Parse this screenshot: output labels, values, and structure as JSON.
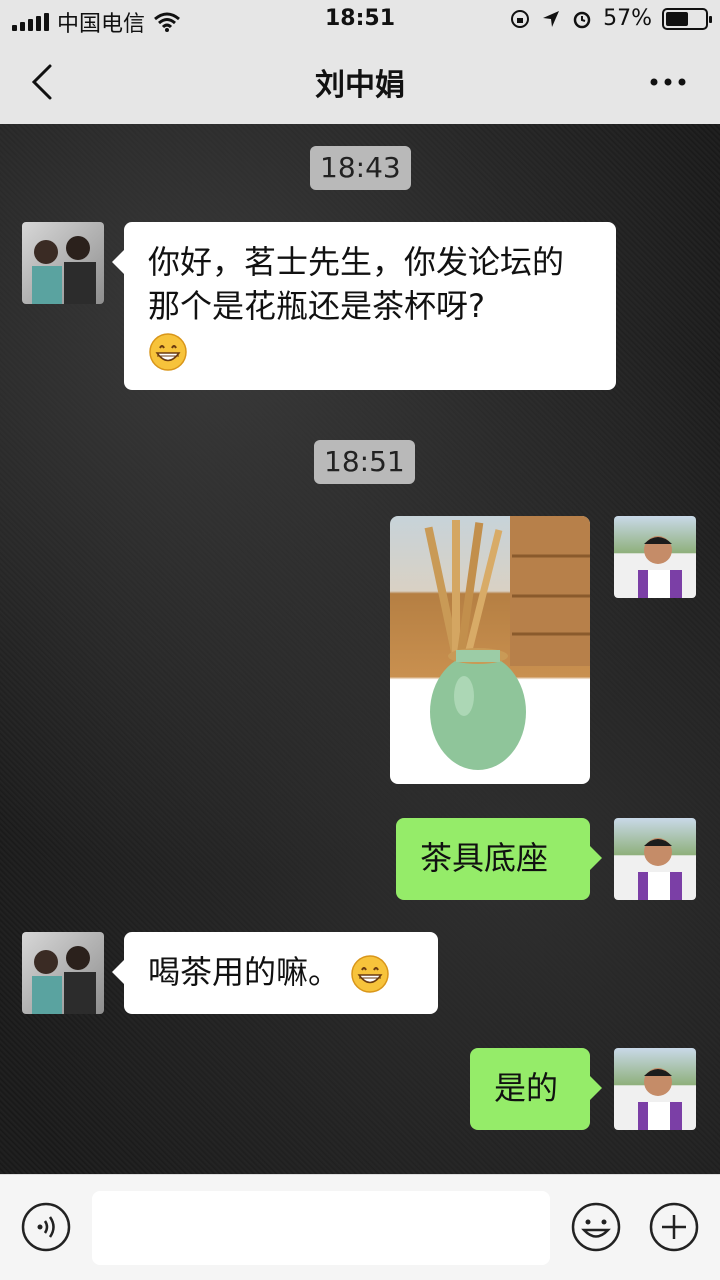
{
  "status_bar": {
    "carrier": "中国电信",
    "time": "18:51",
    "battery": "57%",
    "battery_level": 0.57
  },
  "nav": {
    "title": "刘中娟",
    "back_icon": "chevron-left-icon",
    "more_icon": "more-dots-icon"
  },
  "timestamps": [
    "18:43",
    "18:51"
  ],
  "messages": [
    {
      "side": "left",
      "text": "你好，茗士先生，你发论坛的那个是花瓶还是茶杯呀?",
      "emoji": "grinning-face-icon"
    },
    {
      "side": "right",
      "type": "image"
    },
    {
      "side": "right",
      "text": "茶具底座"
    },
    {
      "side": "left",
      "text": "喝茶用的嘛。",
      "emoji": "grinning-face-icon"
    },
    {
      "side": "right",
      "text": "是的"
    }
  ],
  "input": {
    "value": "",
    "placeholder": ""
  },
  "colors": {
    "nav_bg": "#e6e6e6",
    "chat_bg": "#1c1c1c",
    "bubble_out": "#95ec69",
    "bubble_in": "#ffffff",
    "timestamp_bg": "#b9b9b9"
  }
}
